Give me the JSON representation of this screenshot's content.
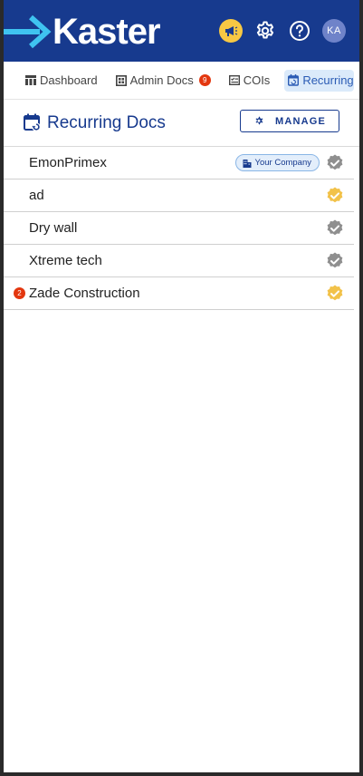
{
  "app": {
    "logo_text": "Kaster",
    "avatar_initials": "KA",
    "brand_color": "#173a8e",
    "announce_color": "#f7c843"
  },
  "tabs": [
    {
      "label": "Dashboard",
      "icon": "dashboard-icon"
    },
    {
      "label": "Admin Docs",
      "icon": "admin-docs-icon",
      "badge": "9"
    },
    {
      "label": "COIs",
      "icon": "coi-icon"
    },
    {
      "label": "Recurring",
      "icon": "calendar-recurring-icon",
      "active": true
    }
  ],
  "page": {
    "title": "Recurring Docs",
    "manage_label": "MANAGE"
  },
  "companies": [
    {
      "name": "EmonPrimex",
      "pill": "Your Company",
      "status": "gray"
    },
    {
      "name": "ad",
      "status": "gold"
    },
    {
      "name": "Dry wall",
      "status": "gray"
    },
    {
      "name": "Xtreme tech",
      "status": "gray"
    },
    {
      "name": "Zade Construction",
      "status": "gold",
      "badge": "2"
    }
  ],
  "status_colors": {
    "gray": "#8f8f8f",
    "gold": "#f2c24a"
  }
}
